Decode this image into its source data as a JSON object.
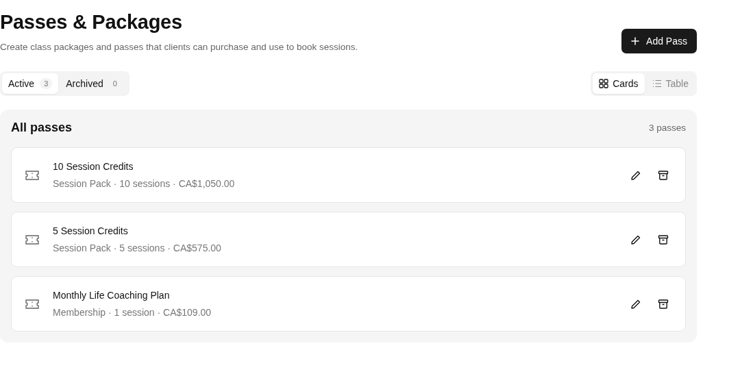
{
  "header": {
    "title": "Passes & Packages",
    "subtitle": "Create class packages and passes that clients can purchase and use to book sessions.",
    "add_button": "Add Pass"
  },
  "tabs": [
    {
      "label": "Active",
      "count": "3",
      "selected": true
    },
    {
      "label": "Archived",
      "count": "0",
      "selected": false
    }
  ],
  "view_toggle": [
    {
      "label": "Cards",
      "kind": "cards",
      "selected": true
    },
    {
      "label": "Table",
      "kind": "table",
      "selected": false
    }
  ],
  "panel": {
    "title": "All passes",
    "count": "3 passes",
    "passes": [
      {
        "name": "10 Session Credits",
        "details": "Session Pack · 10 sessions · CA$1,050.00"
      },
      {
        "name": "5 Session Credits",
        "details": "Session Pack · 5 sessions · CA$575.00"
      },
      {
        "name": "Monthly Life Coaching Plan",
        "details": "Membership · 1 session · CA$109.00"
      }
    ]
  }
}
